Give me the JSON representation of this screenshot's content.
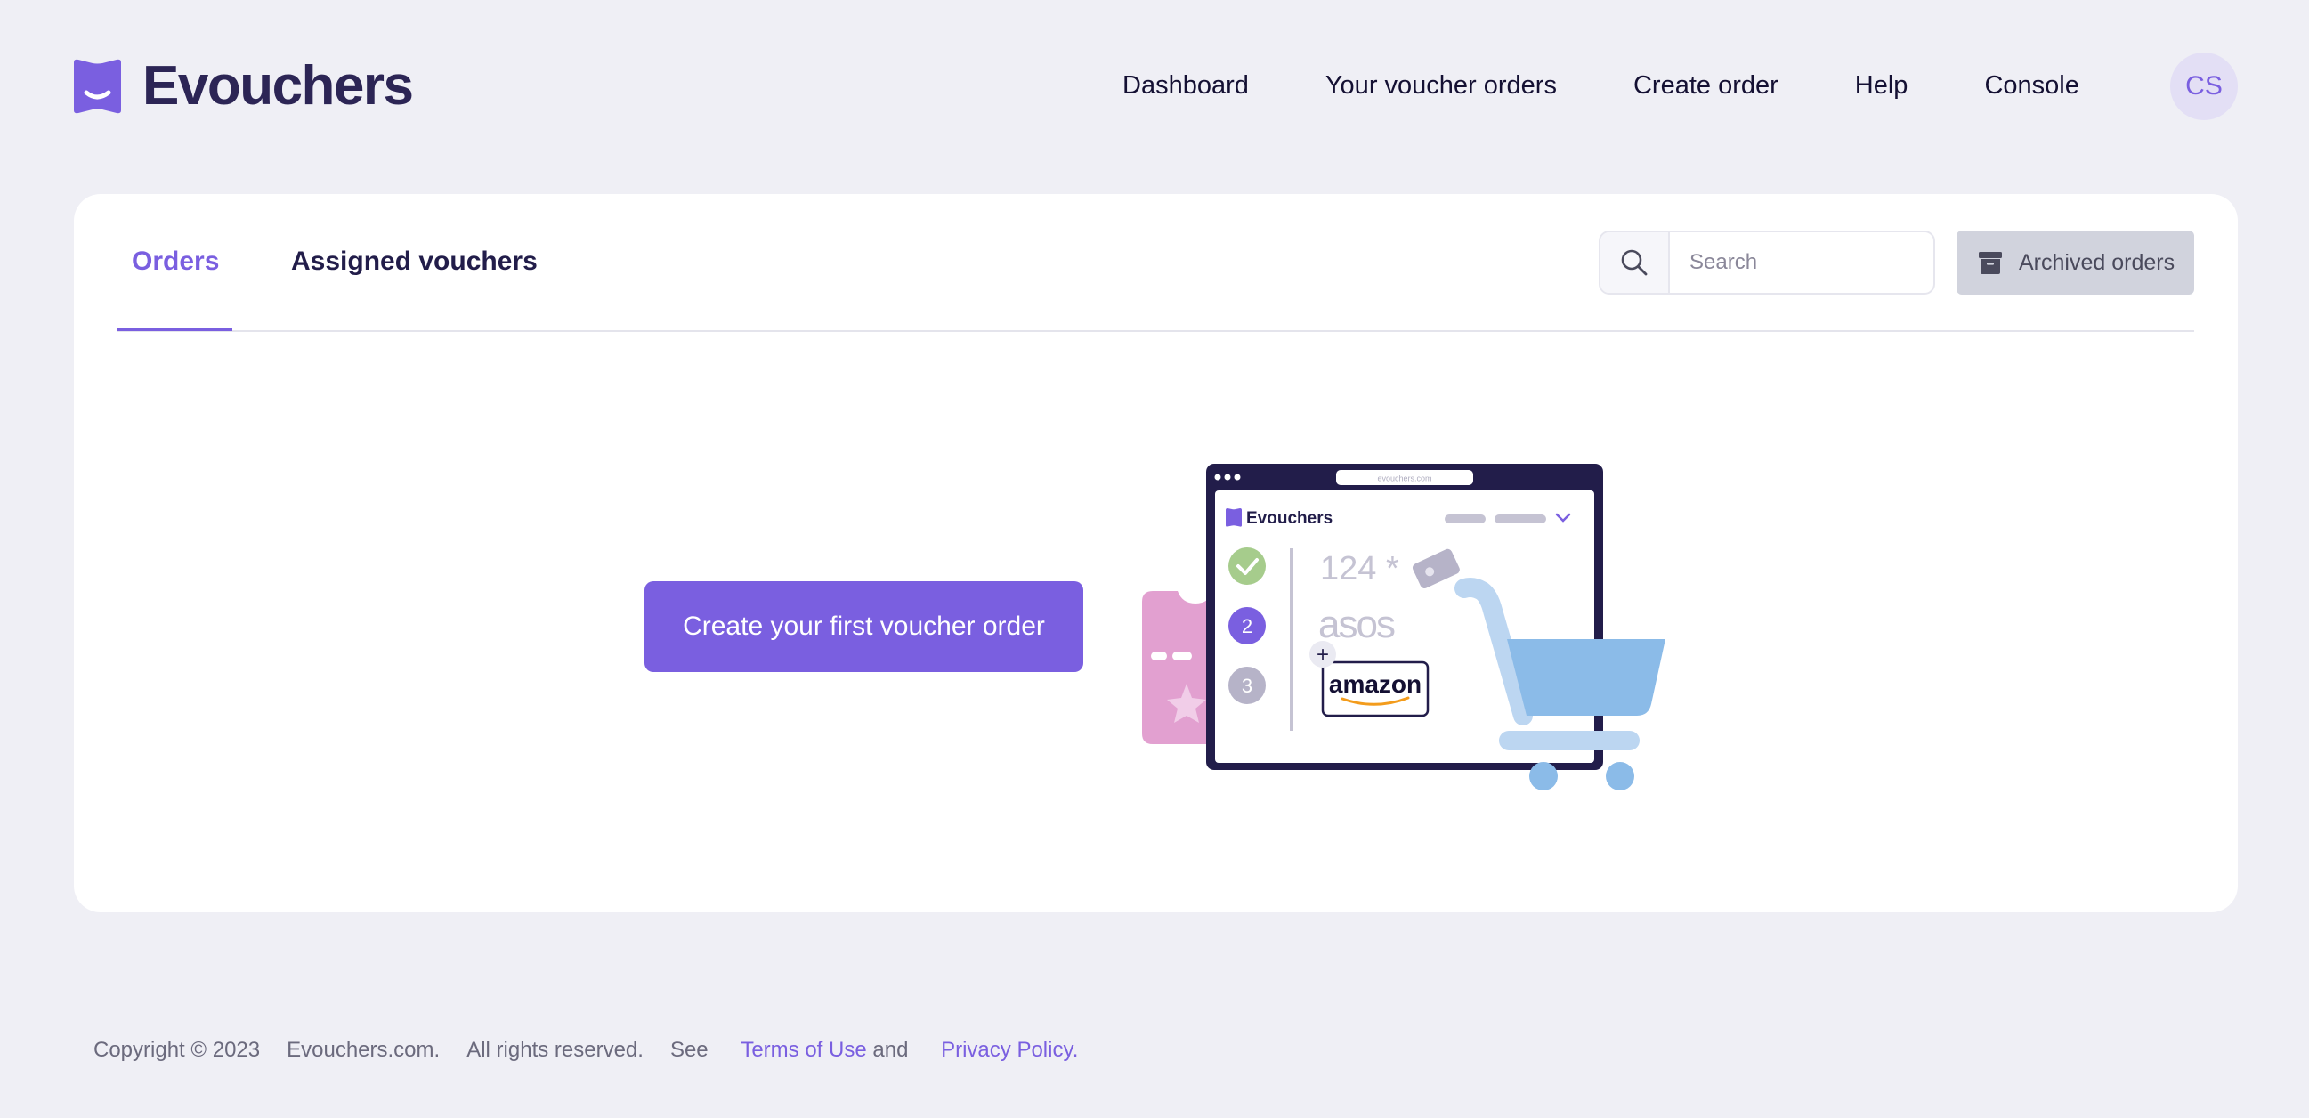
{
  "brand": {
    "name": "Evouchers",
    "accent": "#7a5fe0"
  },
  "nav": {
    "items": [
      "Dashboard",
      "Your voucher orders",
      "Create order",
      "Help",
      "Console"
    ],
    "avatar_initials": "CS"
  },
  "tabs": [
    {
      "label": "Orders",
      "active": true
    },
    {
      "label": "Assigned vouchers",
      "active": false
    }
  ],
  "search": {
    "placeholder": "Search",
    "icon": "search-icon"
  },
  "archived_button": {
    "label": "Archived orders",
    "icon": "archive-icon"
  },
  "empty_state": {
    "cta_label": "Create your first voucher order",
    "illustration": {
      "url": "evouchers.com",
      "brand": "Evouchers",
      "steps": [
        "2",
        "3"
      ],
      "amount_text": "124 *",
      "brand_logos": [
        "asos",
        "amazon"
      ],
      "plus": "+"
    }
  },
  "footer": {
    "copyright": "Copyright © 2023",
    "site": "Evouchers.com.",
    "rights": "All rights reserved.",
    "see": "See",
    "terms": "Terms of Use",
    "and": "and",
    "privacy": "Privacy Policy",
    "period": "."
  }
}
